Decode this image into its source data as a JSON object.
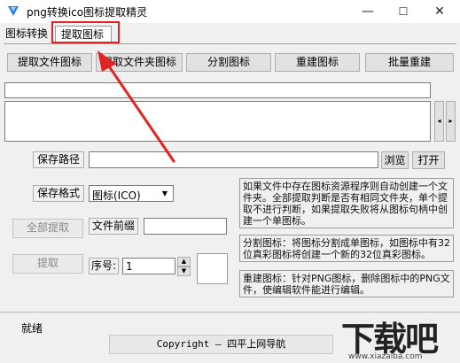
{
  "window": {
    "title": "png转换ico图标提取精灵",
    "minimize": "—",
    "maximize": "☐",
    "close": "✕"
  },
  "tabs": [
    {
      "label": "图标转换"
    },
    {
      "label": "提取图标"
    }
  ],
  "toolbar": {
    "extract_file_icon": "提取文件图标",
    "extract_folder_icon": "提取文件夹图标",
    "split_icon": "分割图标",
    "rebuild_icon": "重建图标",
    "batch_rebuild": "批量重建"
  },
  "scroll": {
    "left": "◂",
    "right": "▸"
  },
  "save_path": {
    "label": "保存路径",
    "value": "",
    "browse": "浏览",
    "open": "打开"
  },
  "save_format": {
    "label": "保存格式",
    "selected": "图标(ICO)"
  },
  "actions": {
    "extract_all": "全部提取",
    "prefix_label": "文件前缀",
    "prefix_value": "",
    "extract": "提取",
    "index_label": "序号:",
    "index_value": "1"
  },
  "info": {
    "extract": "如果文件中存在图标资源程序则自动创建一个文件夹。全部提取判断是否有相同文件夹，单个提取不进行判断，如果提取失败将从图标句柄中创建一个单图标。",
    "split": "分割图标：将图标分割成单图标，如图标中有32位真彩图标将创建一个新的32位真彩图标。",
    "rebuild": "重建图标：针对PNG图标，删除图标中的PNG文件，使编辑软件能进行编辑。"
  },
  "status": {
    "text": "就绪",
    "copyright": "Copyright — 四平上网导航"
  },
  "watermark": {
    "text": "下载吧",
    "url": "www.xiazaiba.com"
  },
  "colors": {
    "highlight": "#e02424",
    "arrow": "#e02424"
  }
}
